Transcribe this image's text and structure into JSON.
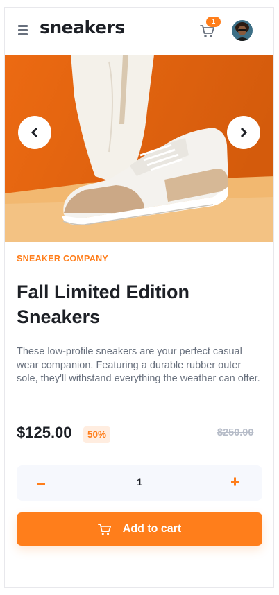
{
  "header": {
    "logo": "sneakers",
    "cart_count": "1",
    "icons": [
      "menu-icon",
      "cart-icon",
      "avatar"
    ]
  },
  "carousel": {
    "prev_icon": "chevron-left-icon",
    "next_icon": "chevron-right-icon"
  },
  "product": {
    "company": "SNEAKER COMPANY",
    "title": "Fall Limited Edition Sneakers",
    "description": "These low-profile sneakers are your perfect casual wear companion. Featuring a durable rubber outer sole, they'll withstand everything the weather can offer.",
    "price": "$125.00",
    "discount": "50%",
    "old_price": "$250.00"
  },
  "quantity": {
    "value": "1",
    "minus_icon": "minus-icon",
    "plus_icon": "plus-icon"
  },
  "add_to_cart": {
    "label": "Add to cart",
    "icon": "cart-icon"
  },
  "colors": {
    "accent": "#ff7e1b",
    "accent_pale": "#ffede0",
    "text_dark": "#1d2026",
    "text_grey": "#68707d",
    "text_light": "#b6bcc8",
    "qty_bg": "#f6f8fd"
  }
}
